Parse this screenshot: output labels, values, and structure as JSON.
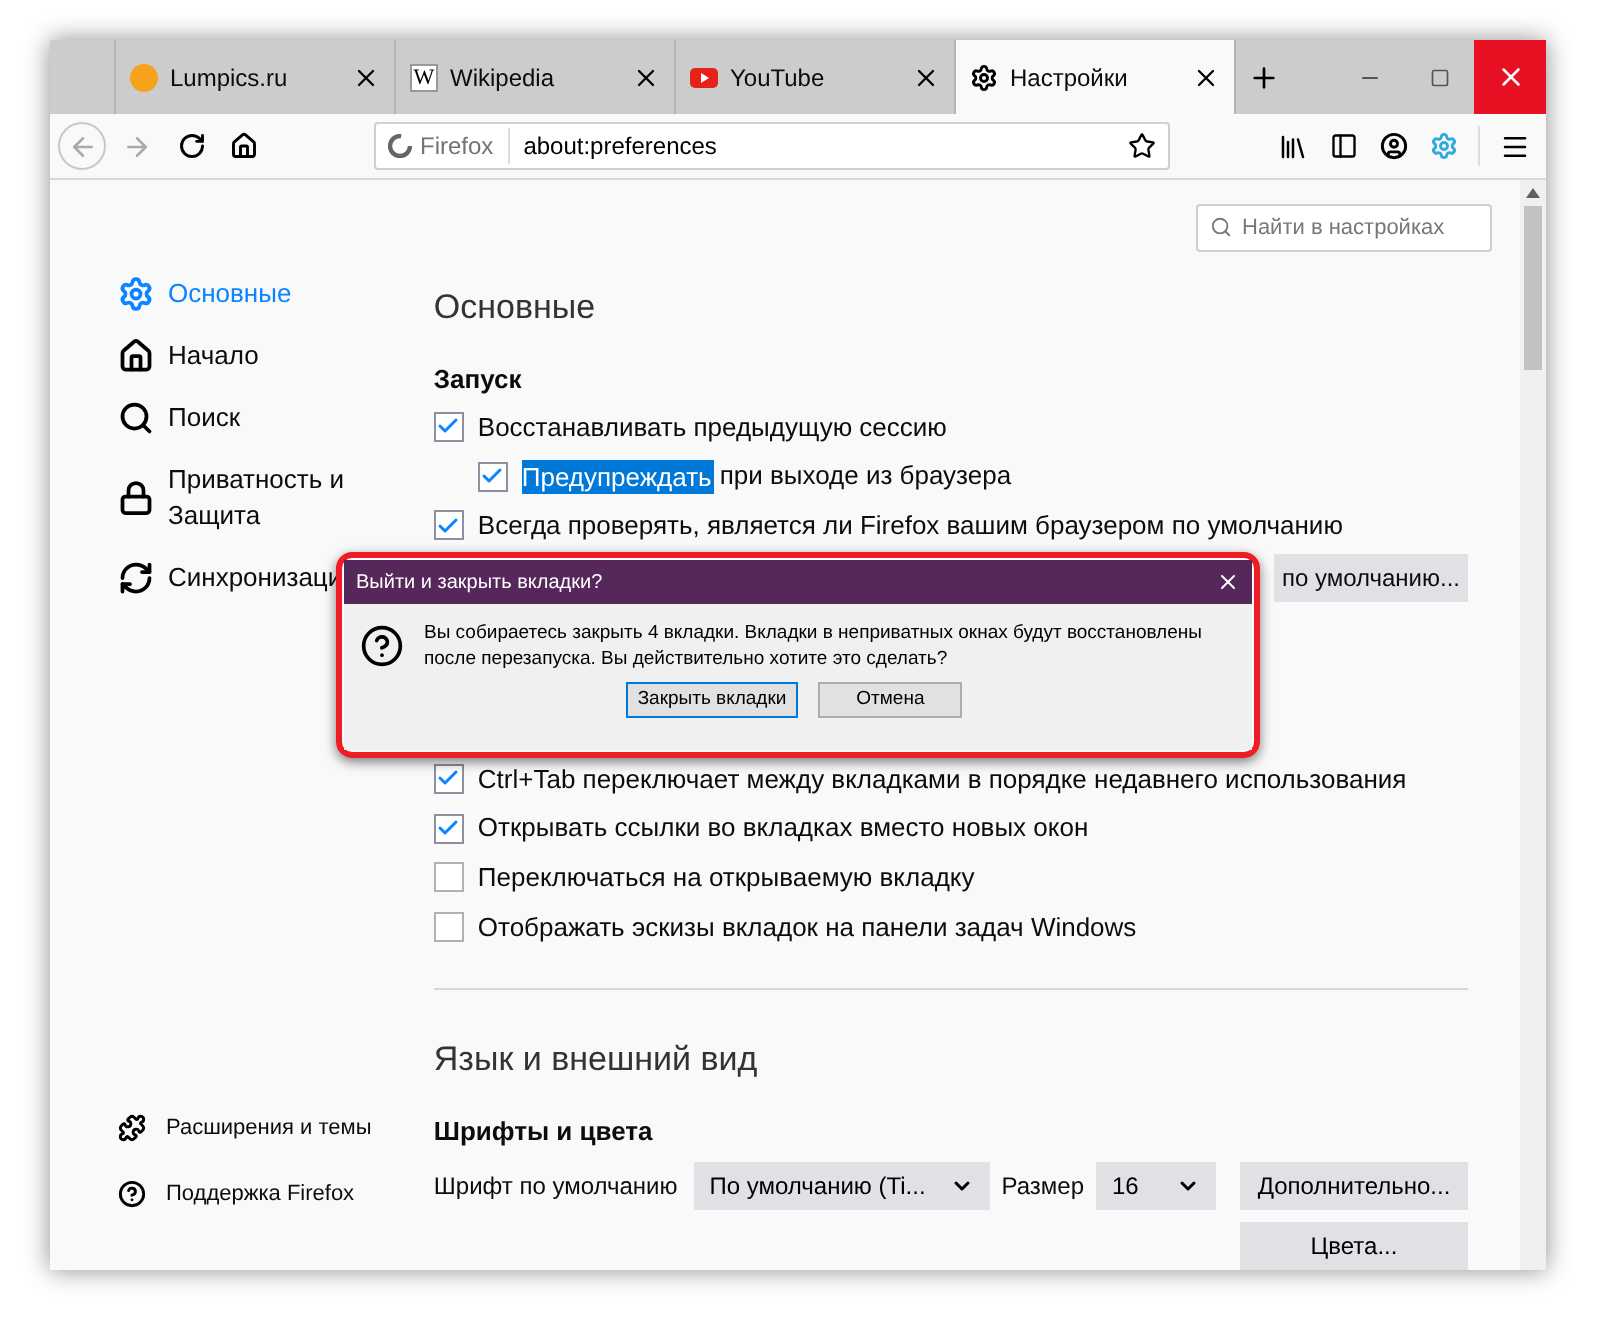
{
  "tabs": [
    {
      "label": "Lumpics.ru",
      "selected": false,
      "kind": "orange"
    },
    {
      "label": "Wikipedia",
      "selected": false,
      "kind": "letter",
      "icon_glyph": "W"
    },
    {
      "label": "YouTube",
      "selected": false,
      "kind": "play"
    },
    {
      "label": "Настройки",
      "selected": true,
      "kind": "gear"
    }
  ],
  "address_bar": {
    "identity": "Firefox",
    "url": "about:preferences"
  },
  "search": {
    "placeholder": "Найти в настройках"
  },
  "sidebar": {
    "items": [
      {
        "label": "Основные",
        "selected": true,
        "kind": "gear"
      },
      {
        "label": "Начало",
        "selected": false,
        "kind": "home"
      },
      {
        "label": "Поиск",
        "selected": false,
        "kind": "search"
      },
      {
        "label": "Приватность и Защита",
        "selected": false,
        "kind": "lock"
      },
      {
        "label": "Синхронизаци",
        "selected": false,
        "kind": "sync"
      }
    ],
    "footer_links": [
      {
        "label": "Расширения и темы",
        "kind": "puzzle"
      },
      {
        "label": "Поддержка Firefox",
        "kind": "help"
      }
    ]
  },
  "main": {
    "title": "Основные",
    "startup": {
      "heading": "Запуск",
      "options": [
        {
          "label": "Восстанавливать предыдущую сессию",
          "checked": true,
          "children": [
            {
              "highlighted": "Предупреждать",
              "label": "при выходе из браузера",
              "checked": true
            }
          ]
        },
        {
          "label": "Всегда проверять, является ли Firefox вашим браузером по умолчанию",
          "checked": true
        }
      ],
      "default_button": "по умолчанию..."
    },
    "tab_options": [
      {
        "label": "Ctrl+Tab переключает между вкладками в порядке недавнего использования",
        "checked": true
      },
      {
        "label": "Открывать ссылки во вкладках вместо новых окон",
        "checked": true
      },
      {
        "label": "Переключаться на открываемую вкладку",
        "checked": false
      },
      {
        "label": "Отображать эскизы вкладок на панели задач Windows",
        "checked": false
      }
    ],
    "language_section": {
      "title": "Язык и внешний вид",
      "fonts_heading": "Шрифты и цвета",
      "font_label": "Шрифт по умолчанию",
      "font_value": "По умолчанию (Ti...",
      "size_label": "Размер",
      "size_value": "16",
      "advanced_button": "Дополнительно...",
      "colors_button": "Цвета..."
    }
  },
  "dialog": {
    "title": "Выйти и закрыть вкладки?",
    "message": "Вы собираетесь закрыть 4 вкладки. Вкладки в неприватных окнах будут восстановлены после перезапуска. Вы действительно хотите это сделать?",
    "buttons": [
      {
        "label": "Закрыть вкладки",
        "focused": true
      },
      {
        "label": "Отмена",
        "focused": false
      }
    ]
  }
}
